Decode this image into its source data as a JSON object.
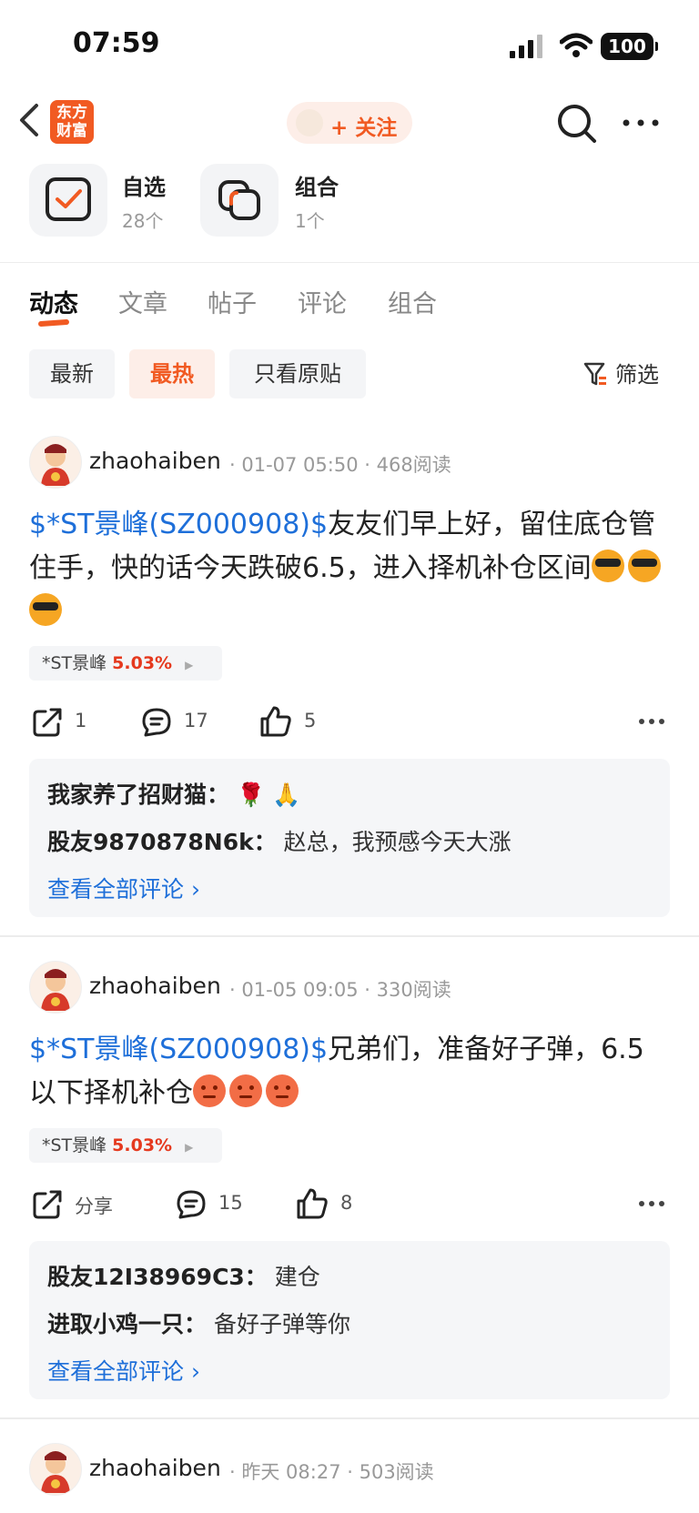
{
  "status": {
    "time": "07:59",
    "battery": "100"
  },
  "nav": {
    "logo_line1": "东方",
    "logo_line2": "财富",
    "follow_label": "+ 关注"
  },
  "tiles": [
    {
      "title": "自选",
      "sub": "28个"
    },
    {
      "title": "组合",
      "sub": "1个"
    }
  ],
  "tabs": [
    "动态",
    "文章",
    "帖子",
    "评论",
    "组合"
  ],
  "filters": [
    "最新",
    "最热",
    "只看原贴"
  ],
  "filter_label": "筛选",
  "posts": [
    {
      "user": "zhaohaiben",
      "time": "01-07 05:50",
      "reads": "468阅读",
      "link": "$*ST景峰(SZ000908)$",
      "text": "友友们早上好，留住底仓管住手，快的话今天跌破6.5，进入择机补仓区间",
      "stock": "*ST景峰",
      "pct": "5.03%",
      "share": "1",
      "comments": "17",
      "likes": "5",
      "c1_user": "我家养了招财猫：",
      "c1_text": "🌹 🙏",
      "c2_user": "股友9870878N6k：",
      "c2_text": "赵总，我预感今天大涨",
      "view_all": "查看全部评论 ›"
    },
    {
      "user": "zhaohaiben",
      "time": "01-05 09:05",
      "reads": "330阅读",
      "link": "$*ST景峰(SZ000908)$",
      "text": "兄弟们，准备好子弹，6.5以下择机补仓",
      "stock": "*ST景峰",
      "pct": "5.03%",
      "share": "分享",
      "comments": "15",
      "likes": "8",
      "c1_user": "股友12I38969C3：",
      "c1_text": "建仓",
      "c2_user": "进取小鸡一只：",
      "c2_text": "备好子弹等你",
      "view_all": "查看全部评论 ›"
    },
    {
      "user": "zhaohaiben",
      "time": "昨天 08:27",
      "reads": "503阅读"
    }
  ]
}
